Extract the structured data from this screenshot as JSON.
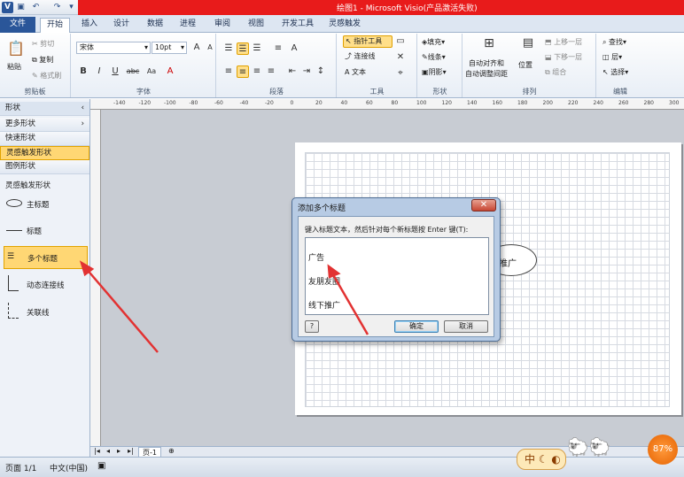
{
  "window": {
    "title": "绘图1 - Microsoft Visio(产品激活失败)"
  },
  "quick_access": {
    "icons": [
      "visio-icon",
      "save-icon",
      "undo-icon",
      "redo-icon",
      "customize-icon"
    ]
  },
  "tabs": [
    "文件",
    "开始",
    "插入",
    "设计",
    "数据",
    "进程",
    "审阅",
    "视图",
    "开发工具",
    "灵感触发"
  ],
  "ribbon": {
    "clipboard": {
      "paste": "粘贴",
      "cut": "剪切",
      "copy": "复制",
      "format_painter": "格式刷",
      "label": "剪贴板"
    },
    "font": {
      "name": "宋体",
      "size": "10pt",
      "bold": "B",
      "italic": "I",
      "underline": "U",
      "strike": "abc",
      "aa": "Aa",
      "label": "字体"
    },
    "paragraph": {
      "label": "段落"
    },
    "tools": {
      "pointer": "指针工具",
      "connector": "连接线",
      "text": "文本",
      "label": "工具"
    },
    "shape": {
      "fill": "填充",
      "line": "线条",
      "shadow": "阴影",
      "label": "形状"
    },
    "arrange": {
      "auto_align": "自动对齐和",
      "auto_space": "自动调整间距",
      "position": "位置",
      "bring_forward": "上移一层",
      "send_backward": "下移一层",
      "group": "组合",
      "label": "排列"
    },
    "edit": {
      "find": "查找",
      "layer": "层",
      "select": "选择",
      "label": "编辑"
    }
  },
  "left_panel": {
    "header": "形状",
    "more": "更多形状",
    "quick": "快速形状",
    "inspire": "灵感触发形状",
    "legend": "图例形状",
    "section": "灵感触发形状",
    "shapes": [
      "主标题",
      "标题",
      "多个标题",
      "动态连接线",
      "关联线"
    ]
  },
  "ruler": {
    "marks": [
      "-140",
      "-120",
      "-100",
      "-80",
      "-60",
      "-40",
      "-20",
      "0",
      "20",
      "40",
      "60",
      "80",
      "100",
      "120",
      "140",
      "160",
      "180",
      "200",
      "220",
      "240",
      "260",
      "280",
      "300"
    ]
  },
  "canvas": {
    "shape_text": "推广"
  },
  "dialog": {
    "title": "添加多个标题",
    "prompt": "键入标题文本，然后针对每个新标题按 Enter 键(T):",
    "lines": [
      "广告",
      "友朋友圈",
      "线下推广"
    ],
    "ok": "确定",
    "cancel": "取消",
    "help": "?"
  },
  "page_tabs": {
    "page": "页-1"
  },
  "status": {
    "page": "页面 1/1",
    "lang": "中文(中国)"
  },
  "tray": {
    "ime": "中",
    "zoom_badge": "87%"
  },
  "colors": {
    "accent": "#2a5699",
    "highlight": "#ffdf8a",
    "titlebar_red": "#e81b1b",
    "arrow": "#e23232"
  }
}
